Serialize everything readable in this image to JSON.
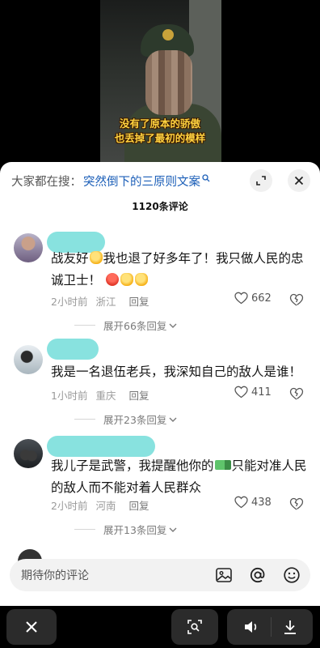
{
  "video": {
    "caption_line1": "没有了原本的骄傲",
    "caption_line2": "也丢掉了最初的模样"
  },
  "sheet": {
    "search_prefix": "大家都在搜：",
    "search_term": "突然倒下的三原则文案",
    "comment_count_title": "1120条评论"
  },
  "comments": [
    {
      "text_part1": "战友好",
      "text_part2": "我也退了好多年了！我只做人民的忠诚卫士！",
      "time": "2小时前",
      "location": "浙江",
      "reply": "回复",
      "likes": "662",
      "expand": "展开66条回复"
    },
    {
      "text": "我是一名退伍老兵，我深知自己的敌人是谁！",
      "time": "1小时前",
      "location": "重庆",
      "reply": "回复",
      "likes": "411",
      "expand": "展开23条回复"
    },
    {
      "text_part1": "我儿子是武警，我提醒他你的",
      "text_part2": "只能对准人民的敌人而不能对着人民群众",
      "time": "2小时前",
      "location": "河南",
      "reply": "回复",
      "likes": "438",
      "expand": "展开13条回复"
    }
  ],
  "input": {
    "placeholder": "期待你的评论"
  },
  "icons": {
    "search": "search-icon",
    "expand": "expand-icon",
    "close": "close-icon",
    "heart": "heart-icon",
    "broken_heart": "broken-heart-icon",
    "image": "image-icon",
    "at": "at-icon",
    "emoji": "smiley-icon",
    "lens": "image-search-icon",
    "volume": "volume-icon",
    "download": "download-icon"
  },
  "colors": {
    "caption": "#ffd23f",
    "search_term": "#1c5fb8",
    "name_blur": "#7ee0dc"
  }
}
